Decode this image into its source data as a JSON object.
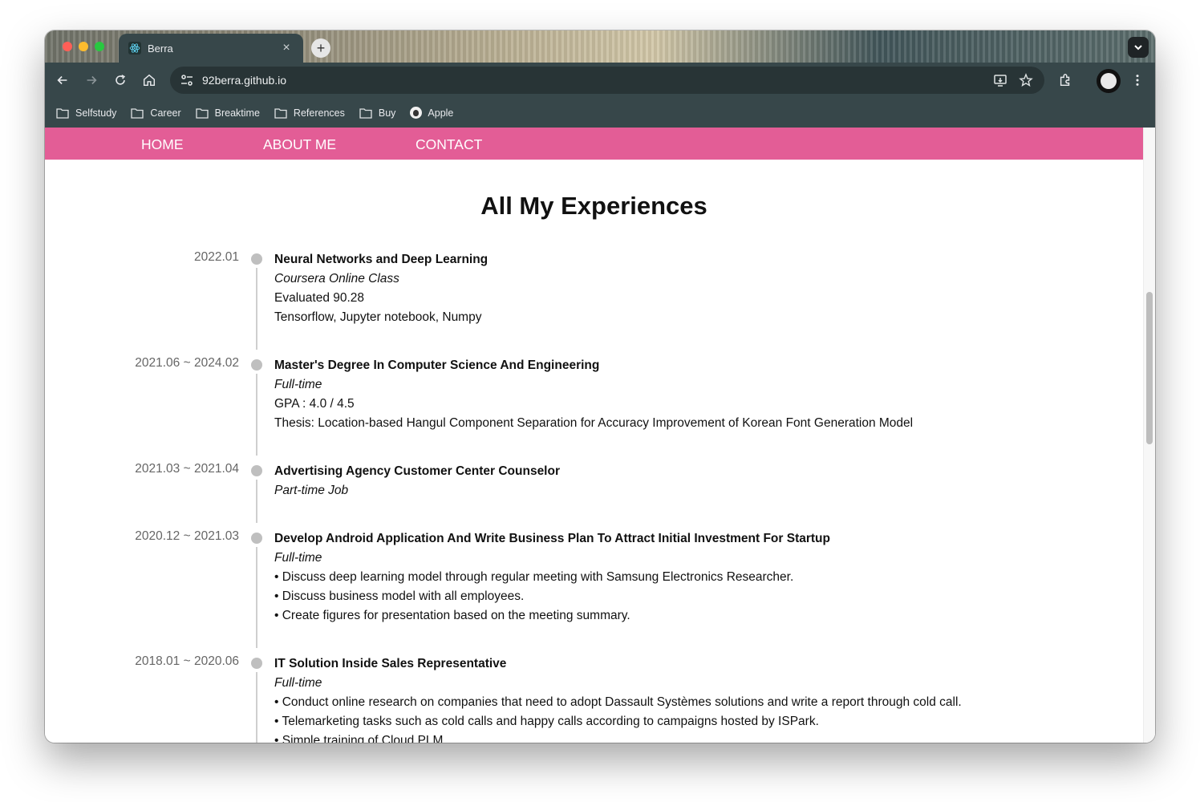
{
  "browser": {
    "tab_title": "Berra",
    "tab_close": "×",
    "new_tab": "+",
    "url": "92berra.github.io",
    "bookmarks": [
      {
        "label": "Selfstudy",
        "icon": "folder-icon"
      },
      {
        "label": "Career",
        "icon": "folder-icon"
      },
      {
        "label": "Breaktime",
        "icon": "folder-icon"
      },
      {
        "label": "References",
        "icon": "folder-icon"
      },
      {
        "label": "Buy",
        "icon": "folder-icon"
      },
      {
        "label": "Apple",
        "icon": "apple-icon"
      }
    ]
  },
  "nav": {
    "home": "HOME",
    "about": "ABOUT ME",
    "contact": "CONTACT",
    "bar_color": "#e35d96"
  },
  "page": {
    "heading": "All My Experiences"
  },
  "experiences": [
    {
      "date": "2022.01",
      "title": "Neural Networks and Deep Learning",
      "subtitle": "Coursera Online Class",
      "details": [
        "Evaluated 90.28",
        "Tensorflow, Jupyter notebook, Numpy"
      ]
    },
    {
      "date": "2021.06 ~ 2024.02",
      "title": "Master's Degree In Computer Science And Engineering",
      "subtitle": "Full-time",
      "details": [
        "GPA : 4.0 / 4.5",
        "Thesis: Location-based Hangul Component Separation for Accuracy Improvement of Korean Font Generation Model"
      ]
    },
    {
      "date": "2021.03 ~ 2021.04",
      "title": "Advertising Agency Customer Center Counselor",
      "subtitle": "Part-time Job",
      "details": []
    },
    {
      "date": "2020.12 ~ 2021.03",
      "title": "Develop Android Application And Write Business Plan To Attract Initial Investment For Startup",
      "subtitle": "Full-time",
      "details": [
        "• Discuss deep learning model through regular meeting with Samsung Electronics Researcher.",
        "• Discuss business model with all employees.",
        "• Create figures for presentation based on the meeting summary."
      ]
    },
    {
      "date": "2018.01 ~ 2020.06",
      "title": "IT Solution Inside Sales Representative",
      "subtitle": "Full-time",
      "details": [
        "• Conduct online research on companies that need to adopt Dassault Systèmes solutions and write a report through cold call.",
        "• Telemarketing tasks such as cold calls and happy calls according to campaigns hosted by ISPark.",
        "• Simple training of Cloud PLM."
      ]
    }
  ]
}
